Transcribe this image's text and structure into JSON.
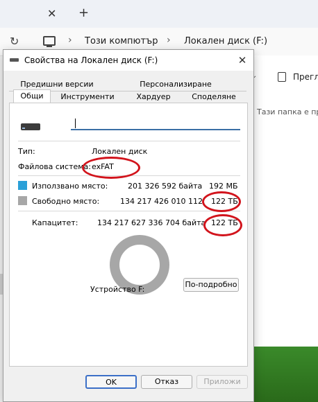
{
  "explorer": {
    "tab_close": "✕",
    "tab_new": "+",
    "breadcrumb": [
      "Този компютър",
      "Локален диск (F:)"
    ],
    "breadcrumb_sep": "›",
    "preview_label": "Прегле",
    "empty_folder_text": "Тази папка е пра"
  },
  "dialog": {
    "title": "Свойства на Локален диск (F:)",
    "close": "✕",
    "tabs_back": [
      "Предишни версии",
      "Персонализиране"
    ],
    "tabs_front": [
      "Общи",
      "Инструменти",
      "Хардуер",
      "Споделяне"
    ],
    "active_tab": "Общи",
    "name_value": "",
    "type_label": "Тип:",
    "type_value": "Локален диск",
    "fs_label": "Файлова система:",
    "fs_value": "exFAT",
    "used_label": "Използвано място:",
    "used_bytes": "201 326 592 байта",
    "used_short": "192 МБ",
    "free_label": "Свободно място:",
    "free_bytes": "134 217 426 010 112",
    "free_short": "122 ТБ",
    "capacity_label": "Капацитет:",
    "capacity_bytes": "134 217 627 336 704 байта",
    "capacity_short": "122 ТБ",
    "device_label": "Устройство F:",
    "details_button": "По-подробно",
    "ok": "OK",
    "cancel": "Отказ",
    "apply": "Приложи",
    "used_color": "#2aa0d8",
    "free_color": "#a7a7a7",
    "annotation_color": "#d2141c"
  }
}
